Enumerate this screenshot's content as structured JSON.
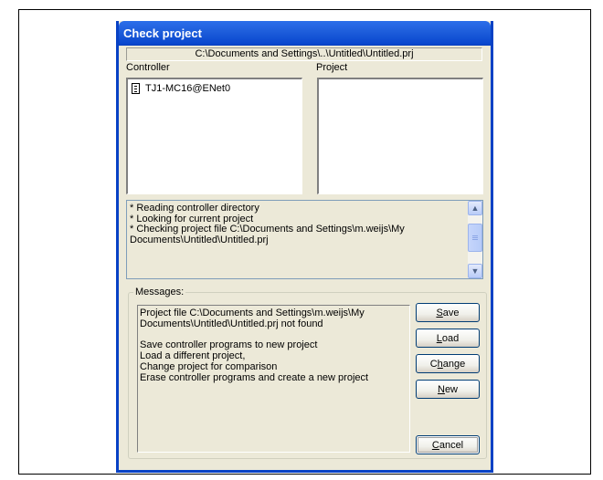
{
  "window": {
    "title": "Check project",
    "path": "C:\\Documents and Settings\\..\\Untitled\\Untitled.prj"
  },
  "columns": {
    "controller_label": "Controller",
    "project_label": "Project"
  },
  "controller_list": [
    {
      "label": "TJ1-MC16@ENet0",
      "icon": "controller-icon"
    }
  ],
  "log_lines": [
    "* Reading controller directory",
    "* Looking for current project",
    "* Checking project file C:\\Documents and Settings\\m.weijs\\My",
    "Documents\\Untitled\\Untitled.prj"
  ],
  "messages": {
    "legend": "Messages:",
    "lines": [
      "Project file  C:\\Documents and Settings\\m.weijs\\My",
      "Documents\\Untitled\\Untitled.prj  not found",
      "Save controller programs to new project",
      "Load a different project,",
      "Change project for comparison",
      "Erase controller programs and create a new project"
    ]
  },
  "buttons": {
    "save": {
      "mnemonic": "S",
      "rest": "ave"
    },
    "load": {
      "mnemonic": "L",
      "rest": "oad"
    },
    "change_pre": "C",
    "change_mnemonic": "h",
    "change_rest": "ange",
    "new": {
      "mnemonic": "N",
      "rest": "ew"
    },
    "cancel": {
      "mnemonic": "C",
      "rest": "ancel"
    }
  },
  "colors": {
    "title_bar": "#0A48CF",
    "dialog_bg": "#ECE9D8",
    "button_border": "#003C74"
  }
}
